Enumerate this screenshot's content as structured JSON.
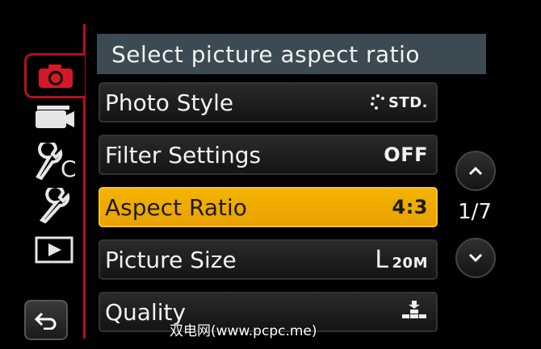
{
  "header": {
    "title": "Select picture aspect ratio"
  },
  "sidebar": {
    "icons": [
      "camera-icon",
      "video-camera-icon",
      "custom-wrench-icon",
      "setup-wrench-icon",
      "playback-icon"
    ],
    "back_icon": "return-arrow-icon",
    "accent": "#b0121a"
  },
  "menu": {
    "items": [
      {
        "label": "Photo Style",
        "value": "STD.",
        "value_icon": "photo-style-std-icon"
      },
      {
        "label": "Filter Settings",
        "value": "OFF"
      },
      {
        "label": "Aspect Ratio",
        "value": "4:3",
        "selected": true
      },
      {
        "label": "Picture Size",
        "value_prefix": "L",
        "value": "20M"
      },
      {
        "label": "Quality",
        "value_icon": "quality-fine-icon"
      }
    ],
    "selected_color": "#f4b300"
  },
  "pager": {
    "indicator": "1/7"
  },
  "watermark": {
    "text": "双电网(www.pcpc.me)"
  }
}
